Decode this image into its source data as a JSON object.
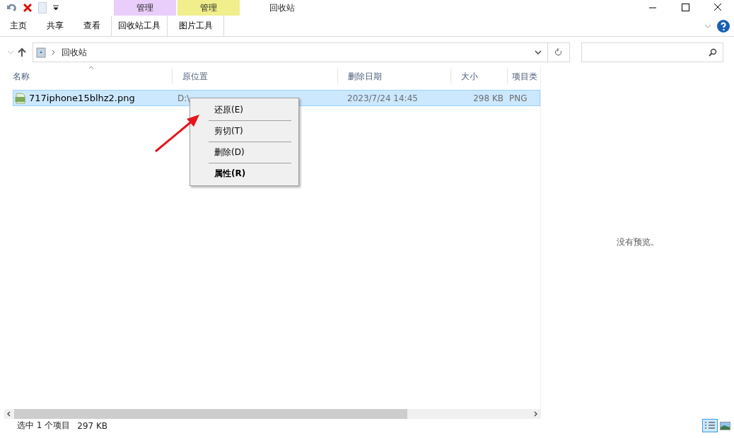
{
  "window": {
    "title": "回收站"
  },
  "context_tabs": [
    {
      "label": "管理",
      "color": "#e9cdfa"
    },
    {
      "label": "管理",
      "color": "#f1ee8c"
    }
  ],
  "ribbon_tabs": [
    {
      "label": "主页",
      "selected": false
    },
    {
      "label": "共享",
      "selected": false
    },
    {
      "label": "查看",
      "selected": false
    },
    {
      "label": "回收站工具",
      "selected": false
    },
    {
      "label": "图片工具",
      "selected": false
    }
  ],
  "address": {
    "path": "回收站"
  },
  "table": {
    "columns": [
      "名称",
      "原位置",
      "删除日期",
      "大小",
      "项目类"
    ],
    "rows": [
      {
        "name": "717iphone15blhz2.png",
        "location": "D:\\",
        "date": "2023/7/24 14:45",
        "size": "298 KB",
        "type": "PNG",
        "selected": true
      }
    ]
  },
  "context_menu": [
    {
      "label": "还原(E)",
      "bold": false
    },
    {
      "label": "剪切(T)",
      "bold": false
    },
    {
      "label": "删除(D)",
      "bold": false
    },
    {
      "label": "属性(R)",
      "bold": true
    }
  ],
  "preview": {
    "message": "没有预览。"
  },
  "status_bar": {
    "selection": "选中 1 个项目",
    "size": "297 KB"
  }
}
